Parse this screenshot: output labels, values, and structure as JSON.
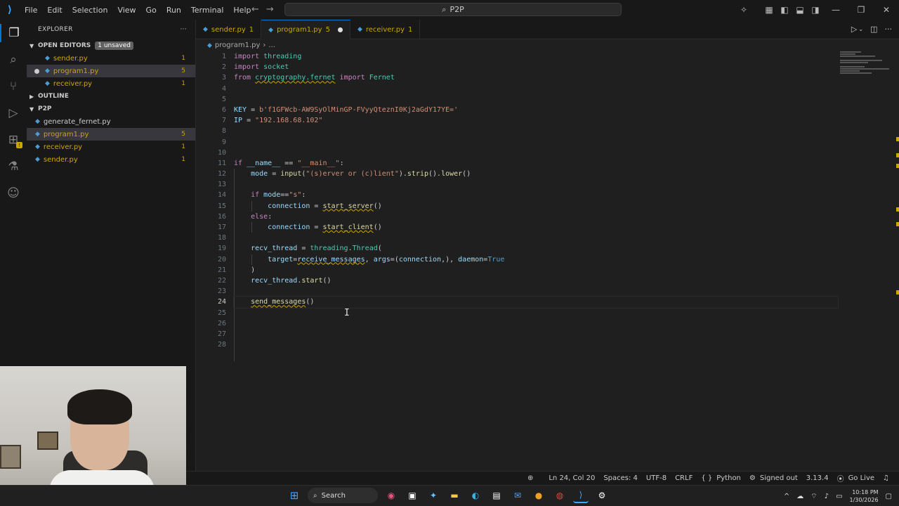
{
  "titlebar": {
    "menu": [
      "File",
      "Edit",
      "Selection",
      "View",
      "Go",
      "Run",
      "Terminal",
      "Help"
    ],
    "search": "P2P"
  },
  "sidebar": {
    "title": "EXPLORER",
    "open_editors": {
      "label": "OPEN EDITORS",
      "badge": "1 unsaved",
      "items": [
        {
          "name": "sender.py",
          "count": "1"
        },
        {
          "name": "program1.py",
          "count": "5"
        },
        {
          "name": "receiver.py",
          "count": "1"
        }
      ]
    },
    "outline_label": "OUTLINE",
    "folder": {
      "label": "P2P",
      "items": [
        {
          "name": "generate_fernet.py",
          "count": ""
        },
        {
          "name": "program1.py",
          "count": "5"
        },
        {
          "name": "receiver.py",
          "count": "1"
        },
        {
          "name": "sender.py",
          "count": "1"
        }
      ]
    }
  },
  "tabs": [
    {
      "label": "sender.py",
      "count": "1"
    },
    {
      "label": "program1.py",
      "count": "5"
    },
    {
      "label": "receiver.py",
      "count": "1"
    }
  ],
  "breadcrumb": {
    "file": "program1.py",
    "rest": "..."
  },
  "editor": {
    "line_numbers": [
      "1",
      "2",
      "3",
      "4",
      "5",
      "6",
      "7",
      "8",
      "9",
      "10",
      "11",
      "12",
      "13",
      "14",
      "15",
      "16",
      "17",
      "18",
      "19",
      "20",
      "21",
      "22",
      "23",
      "24",
      "25",
      "26",
      "27",
      "28"
    ]
  },
  "statusbar": {
    "position": "Ln 24, Col 20",
    "spaces": "Spaces: 4",
    "encoding": "UTF-8",
    "eol": "CRLF",
    "language": "Python",
    "account": "Signed out",
    "version": "3.13.4",
    "golive": "Go Live"
  },
  "taskbar": {
    "search": "Search",
    "time": "10:18 PM",
    "date": "1/30/2026"
  },
  "colors": {
    "accent": "#0078d4",
    "warning": "#cca700"
  }
}
